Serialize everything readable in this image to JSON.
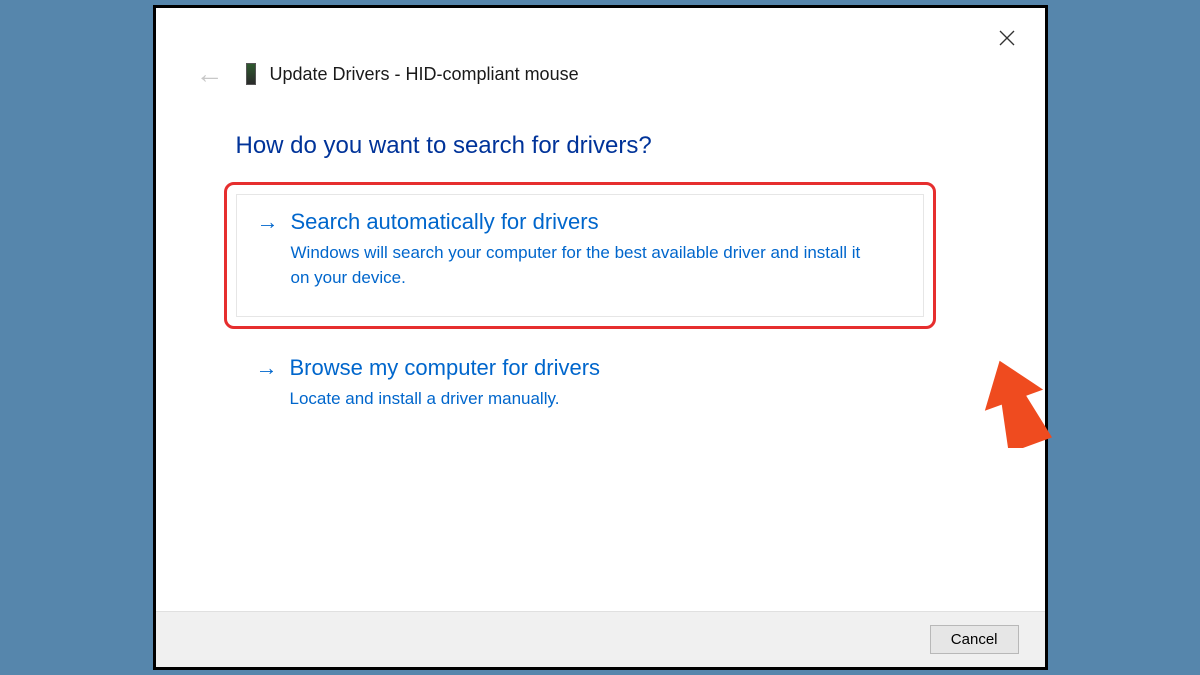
{
  "window": {
    "title": "Update Drivers - HID-compliant mouse"
  },
  "heading": "How do you want to search for drivers?",
  "options": [
    {
      "title": "Search automatically for drivers",
      "desc": "Windows will search your computer for the best available driver and install it on your device."
    },
    {
      "title": "Browse my computer for drivers",
      "desc": "Locate and install a driver manually."
    }
  ],
  "footer": {
    "cancel": "Cancel"
  }
}
